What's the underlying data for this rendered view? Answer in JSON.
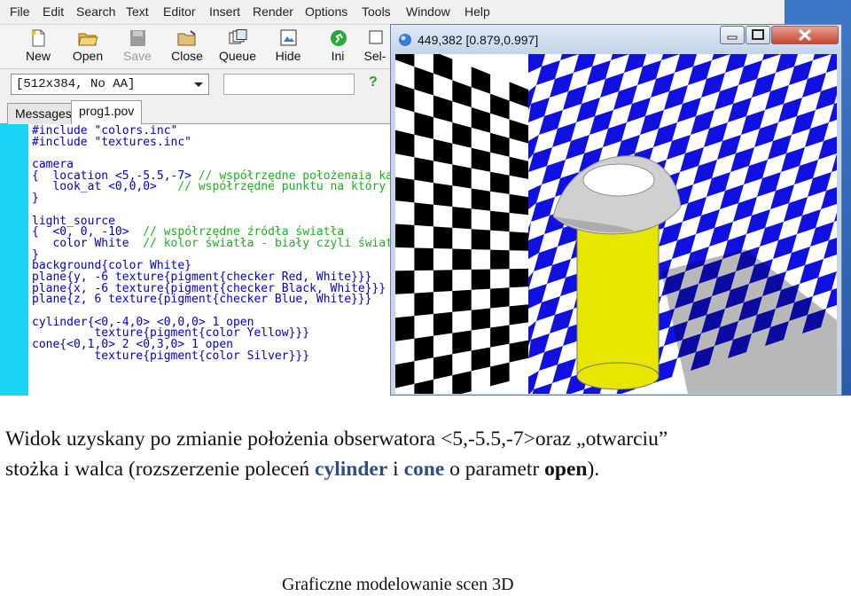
{
  "menu": [
    "File",
    "Edit",
    "Search",
    "Text",
    "Editor",
    "Insert",
    "Render",
    "Options",
    "Tools",
    "Window",
    "Help"
  ],
  "toolbar": {
    "new": "New",
    "open": "Open",
    "save": "Save",
    "close": "Close",
    "queue": "Queue",
    "hide": "Hide",
    "ini": "Ini",
    "sel": "Sel-"
  },
  "render_settings": {
    "selected": "[512x384, No AA]",
    "help": "?"
  },
  "tabs": {
    "messages": "Messages",
    "file": "prog1.pov"
  },
  "code_lines": [
    [
      {
        "t": "#include \"colors.inc\"",
        "c": "kw"
      }
    ],
    [
      {
        "t": "#include \"textures.inc\"",
        "c": "kw"
      }
    ],
    [
      {
        "t": "",
        "c": ""
      }
    ],
    [
      {
        "t": "camera",
        "c": "kw"
      }
    ],
    [
      {
        "t": "{  location <5,-5.5,-7> ",
        "c": "kw"
      },
      {
        "t": "// współrzędne położenaia ka",
        "c": "cm"
      }
    ],
    [
      {
        "t": "   look_at <0,0,0>   ",
        "c": "kw"
      },
      {
        "t": "// współrzędne punktu na który",
        "c": "cm"
      }
    ],
    [
      {
        "t": "}",
        "c": "kw"
      }
    ],
    [
      {
        "t": "",
        "c": ""
      }
    ],
    [
      {
        "t": "light_source",
        "c": "kw"
      }
    ],
    [
      {
        "t": "{  <0, 0, -10>  ",
        "c": "kw"
      },
      {
        "t": "// współrzędne źródła światła",
        "c": "cm"
      }
    ],
    [
      {
        "t": "   color White  ",
        "c": "kw"
      },
      {
        "t": "// kolor światła - biały czyli świat",
        "c": "cm"
      }
    ],
    [
      {
        "t": "}",
        "c": "kw"
      }
    ],
    [
      {
        "t": "background{color White}",
        "c": "kw"
      }
    ],
    [
      {
        "t": "plane{y, -6 texture{pigment{checker Red, White}}}",
        "c": "kw"
      }
    ],
    [
      {
        "t": "plane{x, -6 texture{pigment{checker Black, White}}}",
        "c": "kw"
      }
    ],
    [
      {
        "t": "plane{z, 6 texture{pigment{checker Blue, White}}}",
        "c": "kw"
      }
    ],
    [
      {
        "t": "",
        "c": ""
      }
    ],
    [
      {
        "t": "cylinder{<0,-4,0> <0,0,0> 1 open",
        "c": "kw"
      }
    ],
    [
      {
        "t": "         texture{pigment{color Yellow}}}",
        "c": "kw"
      }
    ],
    [
      {
        "t": "cone{<0,1,0> 2 <0,3,0> 1 open",
        "c": "kw"
      }
    ],
    [
      {
        "t": "         texture{pigment{color Silver}}}",
        "c": "kw"
      }
    ]
  ],
  "render_window": {
    "title": "449,382 [0.879,0.997]"
  },
  "colors": {
    "checker_blue": "#1010e0",
    "checker_black": "#000000",
    "cylinder": "#e6e600",
    "cone": "#c8c8c8",
    "gutter": "#1bd4f5"
  },
  "caption": {
    "line1": "Widok uzyskany po zmianie położenia obserwatora <5,-5.5,-7>oraz „otwarciu”",
    "p1": "stożka i walca (rozszerzenie poleceń ",
    "cylinder": "cylinder",
    "p2": " i ",
    "cone": "cone",
    "p3": " o parametr ",
    "open": "open",
    "p4": ")."
  },
  "footer": "Graficzne modelowanie scen 3D"
}
